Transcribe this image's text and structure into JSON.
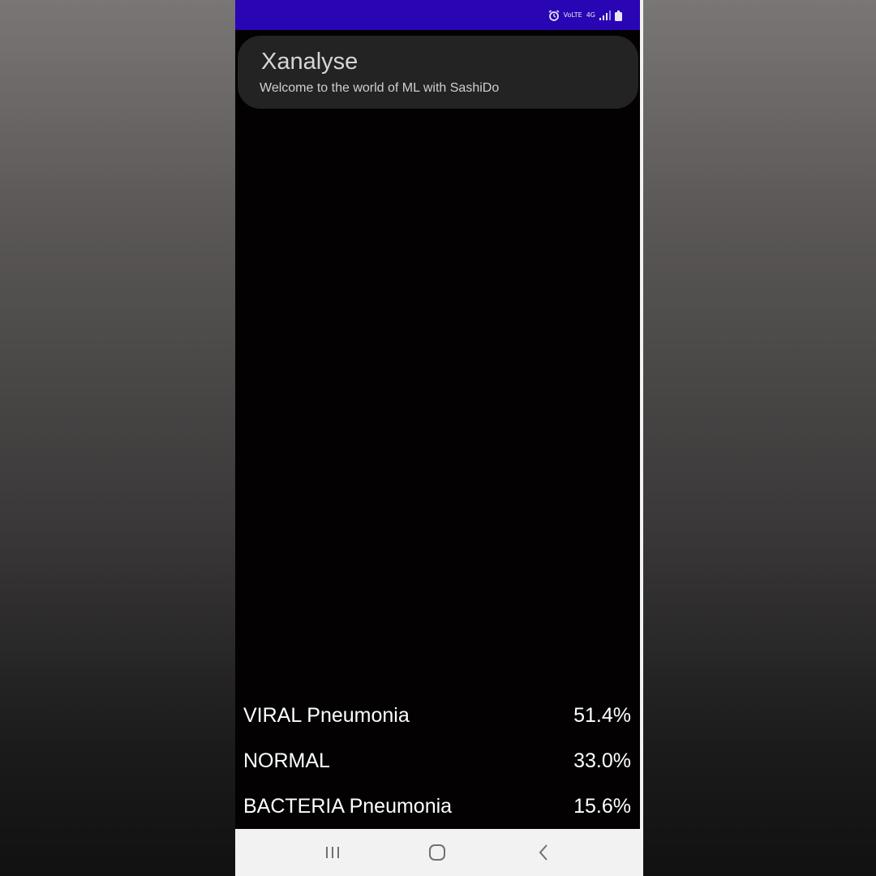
{
  "status_bar": {
    "bg_color": "#2a05b4",
    "icons": [
      "alarm-icon",
      "volte-icon",
      "4g-icon",
      "signal-icon",
      "battery-icon"
    ],
    "volte_text": "VoLTE",
    "network_text": "4G"
  },
  "app_bar": {
    "title": "Xanalyse",
    "subtitle": "Welcome to the world of ML with SashiDo"
  },
  "results": [
    {
      "label": "VIRAL Pneumonia",
      "value": "51.4%"
    },
    {
      "label": "NORMAL",
      "value": "33.0%"
    },
    {
      "label": "BACTERIA Pneumonia",
      "value": "15.6%"
    }
  ],
  "nav_bar": {
    "buttons": [
      "recent-apps-icon",
      "home-icon",
      "back-icon"
    ]
  }
}
